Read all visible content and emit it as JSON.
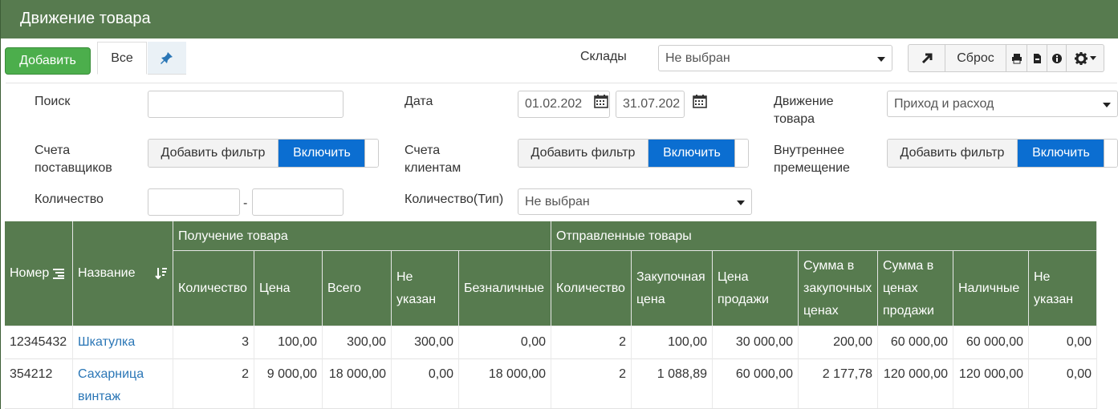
{
  "title": "Движение товара",
  "toolbar": {
    "add": "Добавить",
    "tab_all": "Все",
    "warehouses_label": "Склады",
    "warehouses_value": "Не выбран",
    "reset": "Сброс"
  },
  "filters": {
    "search_label": "Поиск",
    "search_value": "",
    "date_label": "Дата",
    "date_from": "01.02.202",
    "date_to": "31.07.202",
    "movement_label_1": "Движение",
    "movement_label_2": "товара",
    "movement_value": "Приход и расход",
    "supplier_label_1": "Счета",
    "supplier_label_2": "поставщиков",
    "client_label_1": "Счета",
    "client_label_2": "клиентам",
    "internal_label_1": "Внутреннее",
    "internal_label_2": "премещение",
    "add_filter": "Добавить фильтр",
    "enable": "Включить",
    "qty_label": "Количество",
    "qty_dash": "-",
    "qty_type_label": "Количество(Тип)",
    "qty_type_value": "Не выбран"
  },
  "table": {
    "col_number": "Номер",
    "col_name": "Название",
    "group_received": "Получение товара",
    "group_sent": "Отправленные товары",
    "received_cols": [
      [
        "Количество"
      ],
      [
        "Цена"
      ],
      [
        "Всего"
      ],
      [
        "Не",
        "указан"
      ],
      [
        "Безналичные"
      ]
    ],
    "sent_cols": [
      [
        "Количество"
      ],
      [
        "Закупочная",
        "цена"
      ],
      [
        "Цена",
        "продажи"
      ],
      [
        "Сумма в",
        "закупочных",
        "ценах"
      ],
      [
        "Сумма в",
        "ценах",
        "продажи"
      ],
      [
        "Наличные"
      ],
      [
        "Не",
        "указан"
      ]
    ],
    "rows": [
      {
        "number": "12345432",
        "name_lines": [
          "Шкатулка"
        ],
        "values": [
          "3",
          "100,00",
          "300,00",
          "300,00",
          "0,00",
          "2",
          "100,00",
          "30 000,00",
          "200,00",
          "60 000,00",
          "60 000,00",
          "0,00"
        ]
      },
      {
        "number": "354212",
        "name_lines": [
          "Сахарница",
          "винтаж"
        ],
        "values": [
          "2",
          "9 000,00",
          "18 000,00",
          "0,00",
          "18 000,00",
          "2",
          "1 088,89",
          "60 000,00",
          "2 177,78",
          "120 000,00",
          "120 000,00",
          "0,00"
        ]
      }
    ]
  },
  "colors": {
    "header_green": "#577b4f",
    "add_green": "#4cae4c",
    "toggle_blue": "#0b6ed1",
    "link_blue": "#2a76b6"
  }
}
